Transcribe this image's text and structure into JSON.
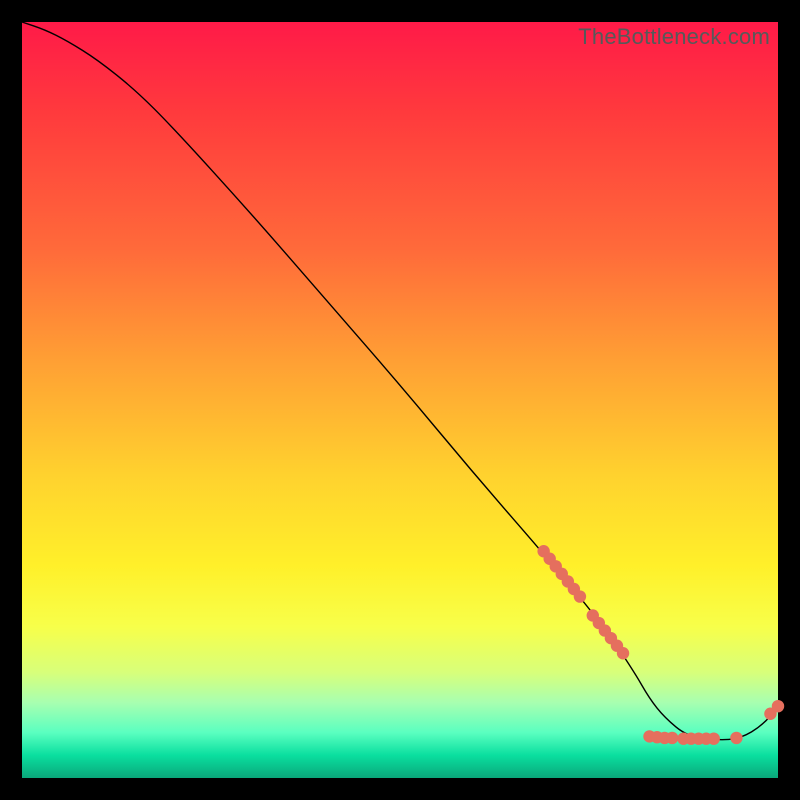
{
  "attribution": "TheBottleneck.com",
  "colors": {
    "page_bg": "#000000",
    "curve": "#000000",
    "dot": "#e56f5e",
    "gradient_top": "#ff1a48",
    "gradient_bottom": "#0aa77a"
  },
  "chart_data": {
    "type": "line",
    "title": "",
    "xlabel": "",
    "ylabel": "",
    "x_range": [
      0,
      100
    ],
    "y_range": [
      0,
      100
    ],
    "grid": false,
    "legend": false,
    "note": "Axes unlabeled in source; values are percent-of-range estimates read from geometry.",
    "series": [
      {
        "name": "curve",
        "kind": "line",
        "x": [
          0,
          3,
          6,
          10,
          15,
          20,
          30,
          40,
          50,
          60,
          70,
          77,
          81,
          83,
          85,
          88,
          92,
          95,
          98,
          100
        ],
        "y": [
          100,
          99,
          97.5,
          95,
          91,
          86,
          75,
          63.5,
          52,
          40,
          28.5,
          20,
          14,
          10.5,
          8,
          5.5,
          5,
          5.2,
          7,
          9.5
        ]
      },
      {
        "name": "upper-dot-cluster",
        "kind": "scatter",
        "x": [
          69.0,
          69.8,
          70.6,
          71.4,
          72.2,
          73.0,
          73.8
        ],
        "y": [
          30.0,
          29.0,
          28.0,
          27.0,
          26.0,
          25.0,
          24.0
        ]
      },
      {
        "name": "mid-dot-cluster",
        "kind": "scatter",
        "x": [
          75.5,
          76.3,
          77.1,
          77.9,
          78.7,
          79.5
        ],
        "y": [
          21.5,
          20.5,
          19.5,
          18.5,
          17.5,
          16.5
        ]
      },
      {
        "name": "bottom-dot-row",
        "kind": "scatter",
        "x": [
          83.0,
          84.0,
          85.0,
          86.0,
          87.5,
          88.5,
          89.5,
          90.5,
          91.5,
          94.5
        ],
        "y": [
          5.5,
          5.4,
          5.3,
          5.3,
          5.2,
          5.2,
          5.2,
          5.2,
          5.2,
          5.3
        ]
      },
      {
        "name": "right-tail-dots",
        "kind": "scatter",
        "x": [
          99.0,
          100.0
        ],
        "y": [
          8.5,
          9.5
        ]
      }
    ]
  }
}
